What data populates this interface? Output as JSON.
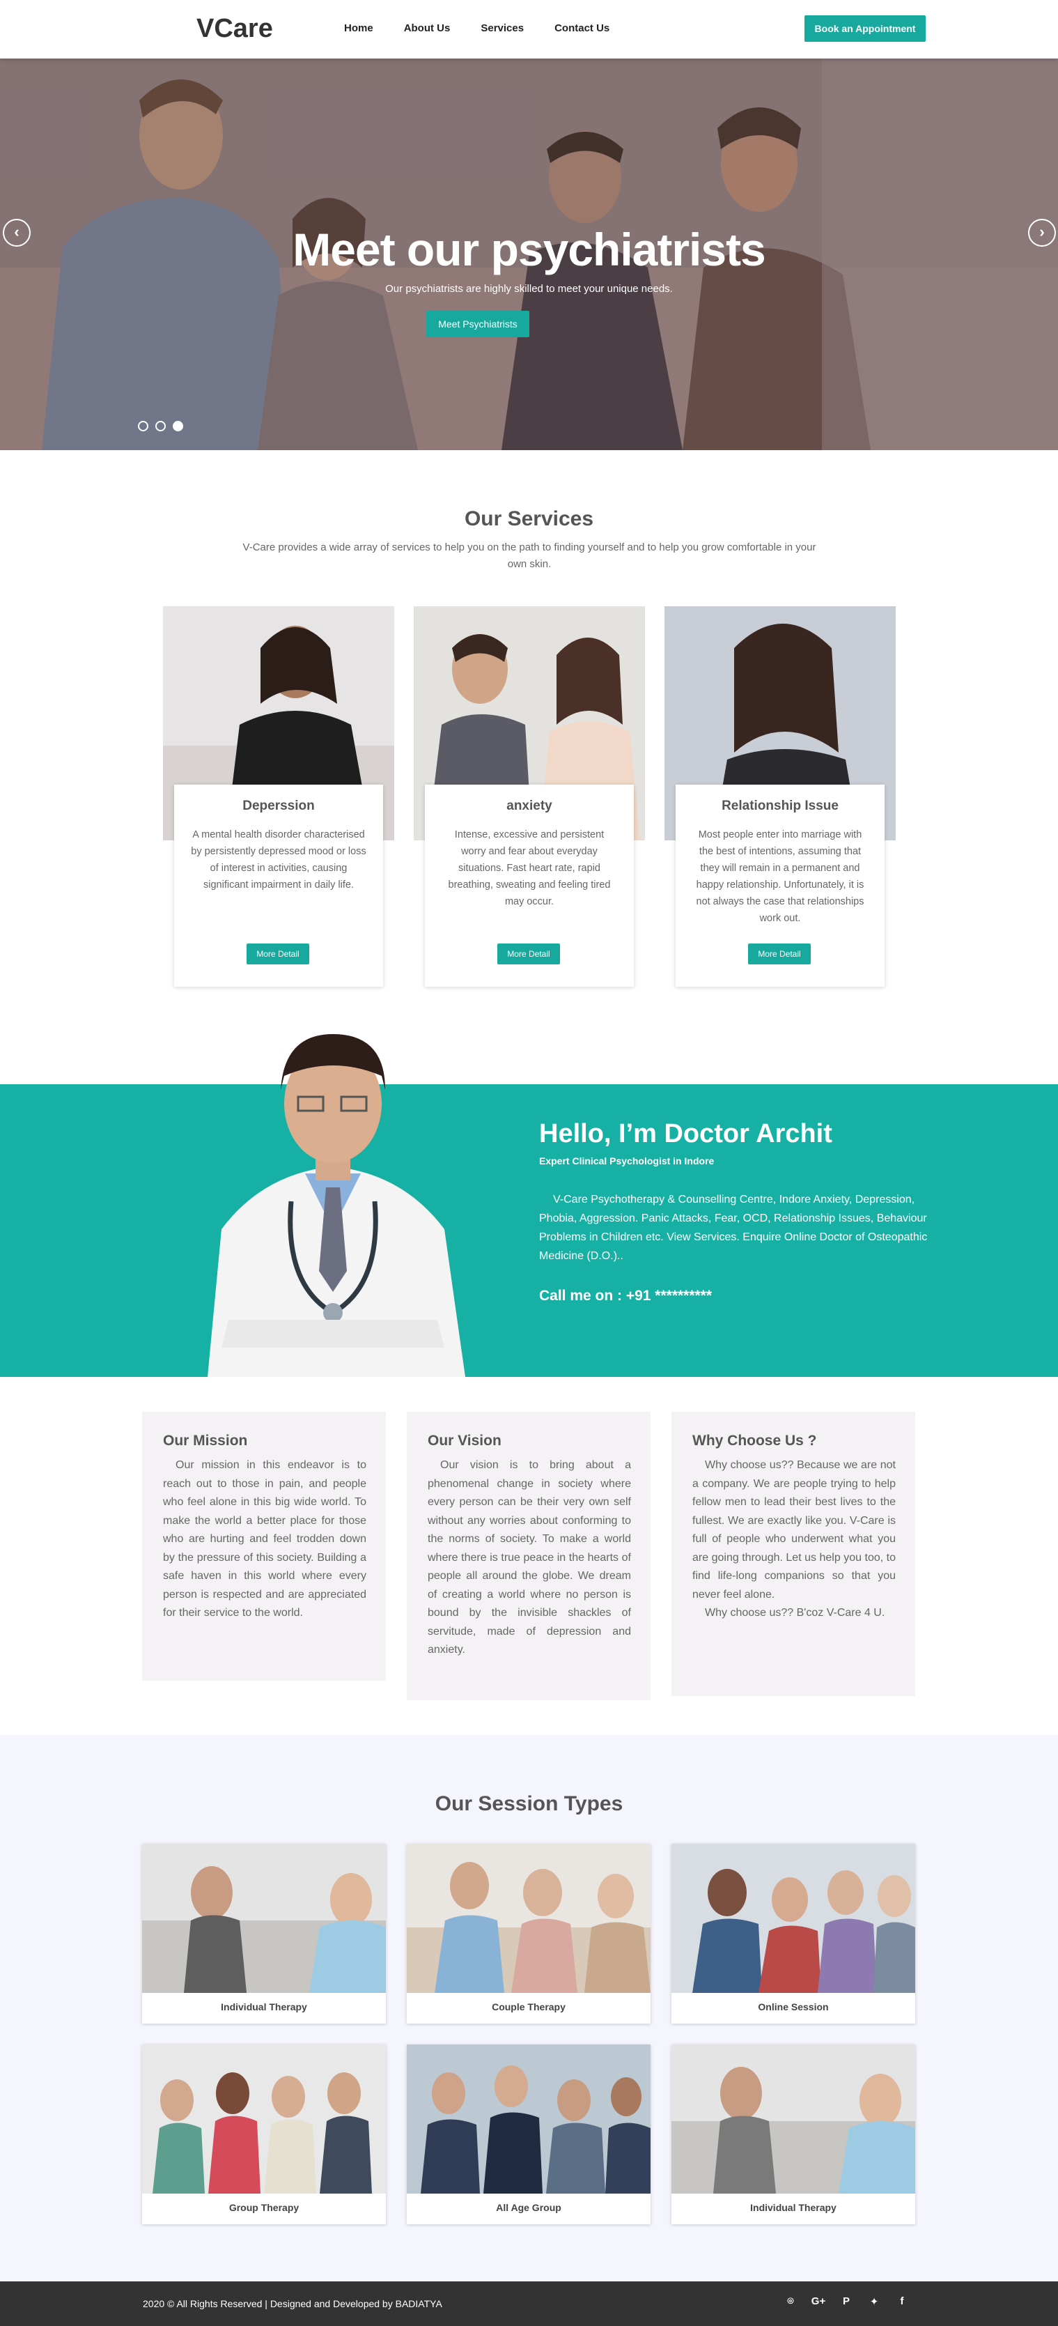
{
  "navbar": {
    "brand": "VCare",
    "links": [
      "Home",
      "About Us",
      "Services",
      "Contact Us"
    ],
    "cta": "Book an Appointment"
  },
  "hero": {
    "title": "Meet our psychiatrists",
    "subtitle": "Our psychiatrists are highly skilled to meet your unique needs.",
    "button": "Meet Psychiatrists",
    "prev_icon": "chevron-left-icon",
    "next_icon": "chevron-right-icon",
    "slide_count": 3,
    "active_slide": 3
  },
  "services": {
    "title": "Our Services",
    "description": "V-Care provides a wide array of services to help you on the path to finding yourself and to help you grow comfortable in your own skin.",
    "items": [
      {
        "title": "Deperssion",
        "text": "A mental health disorder characterised by persistently depressed mood or loss of interest in activities, causing significant impairment in daily life.",
        "button": "More Detail"
      },
      {
        "title": "anxiety",
        "text": "Intense, excessive and persistent worry and fear about everyday situations. Fast heart rate, rapid breathing, sweating and feeling tired may occur.",
        "button": "More Detail"
      },
      {
        "title": "Relationship Issue",
        "text": "Most people enter into marriage with the best of intentions, assuming that they will remain in a permanent and happy relationship. Unfortunately, it is not always the case that relationships work out.",
        "button": "More Detail"
      }
    ]
  },
  "doctor": {
    "name": "Hello, I’m Doctor Archit",
    "role": "Expert Clinical Psychologist in Indore",
    "description": "V-Care Psychotherapy & Counselling Centre, Indore Anxiety, Depression, Phobia, Aggression. Panic Attacks, Fear, OCD, Relationship Issues, Behaviour Problems in Children etc. View Services. Enquire Online Doctor of Osteopathic Medicine (D.O.)..",
    "call": "Call me on : +91 **********"
  },
  "about": [
    {
      "title": "Our Mission",
      "text": "Our mission in this endeavor is to reach out to those in pain, and people who feel alone in this big wide world. To make the world a better place for those who are hurting and feel trodden down by the pressure of this society. Building a safe haven in this world where every person is respected and are appreciated for their service to the world."
    },
    {
      "title": "Our Vision",
      "text": "Our vision is to bring about a phenomenal change in society where every person can be their very own self without any worries about conforming to the norms of society. To make a world where there is true peace in the hearts of people all around the globe. We dream of creating a world where no person is bound by the invisible shackles of servitude, made of depression and anxiety."
    },
    {
      "title": "Why Choose Us ?",
      "text": "Why choose us?? Because we are not a company. We are people trying to help fellow men to lead their best lives to the fullest. We are exactly like you. V-Care is full of people who underwent what you are going through. Let us help you too, to find life-long companions so that you never feel alone.",
      "text2": "Why choose us?? B'coz V-Care 4 U."
    }
  ],
  "sessions": {
    "title": "Our Session Types",
    "items": [
      "Individual Therapy",
      "Couple Therapy",
      "Online Session",
      "Group Therapy",
      "All Age Group",
      "Individual Therapy"
    ]
  },
  "footer": {
    "text": "2020 © All Rights Reserved | Designed and Developed by BADIATYA",
    "social": [
      {
        "icon": "github-icon",
        "glyph": "⌾"
      },
      {
        "icon": "google-plus-icon",
        "glyph": "G+"
      },
      {
        "icon": "pinterest-icon",
        "glyph": "P"
      },
      {
        "icon": "twitter-icon",
        "glyph": "✦"
      },
      {
        "icon": "facebook-icon",
        "glyph": "f"
      }
    ]
  },
  "colors": {
    "accent": "#17a99d",
    "doctor_band": "#17b0a4",
    "footer": "#333333"
  }
}
